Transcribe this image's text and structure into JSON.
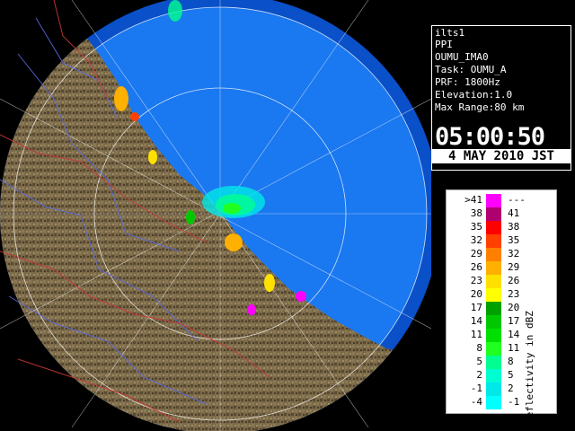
{
  "info": {
    "radar_name": "ilts1",
    "product": "PPI",
    "site": "OUMU_IMA0",
    "task": "Task: OUMU_A",
    "prf": "PRF: 1800Hz",
    "elevation": "Elevation:1.0",
    "max_range": "Max Range:80 km",
    "time": "05:00:50",
    "date": "4 MAY 2010 JST"
  },
  "legend": {
    "title": "Reflectivity in dBZ",
    "rows": [
      {
        "left": ">41",
        "right": "---",
        "color": "#ff00ff"
      },
      {
        "left": "38",
        "right": "41",
        "color": "#b00070"
      },
      {
        "left": "35",
        "right": "38",
        "color": "#ff0000"
      },
      {
        "left": "32",
        "right": "35",
        "color": "#ff4000"
      },
      {
        "left": "29",
        "right": "32",
        "color": "#ff8000"
      },
      {
        "left": "26",
        "right": "29",
        "color": "#ffb000"
      },
      {
        "left": "23",
        "right": "26",
        "color": "#ffe000"
      },
      {
        "left": "20",
        "right": "23",
        "color": "#ffff00"
      },
      {
        "left": "17",
        "right": "20",
        "color": "#00a000"
      },
      {
        "left": "14",
        "right": "17",
        "color": "#00c800"
      },
      {
        "left": "11",
        "right": "14",
        "color": "#00e000"
      },
      {
        "left": "8",
        "right": "11",
        "color": "#20ff20"
      },
      {
        "left": "5",
        "right": "8",
        "color": "#00ff90"
      },
      {
        "left": "2",
        "right": "5",
        "color": "#00ffd0"
      },
      {
        "left": "-1",
        "right": "2",
        "color": "#00e8e8"
      },
      {
        "left": "-4",
        "right": "-1",
        "color": "#00ffff"
      }
    ]
  },
  "colors": {
    "sea": "#1a78f0",
    "sea_outer": "#0a50c8",
    "land": "#7a6a4a",
    "rivers": "#5a6adf",
    "borders": "#c83838"
  }
}
